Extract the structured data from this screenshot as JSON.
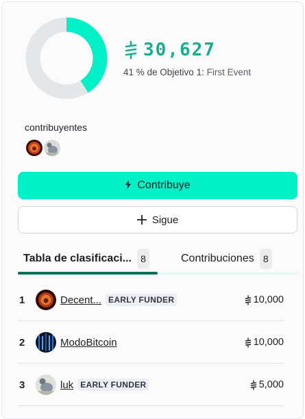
{
  "summary": {
    "amount": "30,627",
    "progress_percent": 41,
    "goal_prefix": "41 % de Objetivo 1:",
    "goal_name": "First Event"
  },
  "contributors": {
    "label": "contribuyentes",
    "avatars": [
      "avatar-lion",
      "avatar-pigeon"
    ]
  },
  "actions": {
    "contribute_label": "Contribuye",
    "follow_label": "Sigue"
  },
  "tabs": [
    {
      "label": "Tabla de clasificaci...",
      "count": "8",
      "active": true
    },
    {
      "label": "Contribuciones",
      "count": "8",
      "active": false
    }
  ],
  "leaderboard": [
    {
      "rank": "1",
      "name": "Decent...",
      "badge": "EARLY FUNDER",
      "amount": "10,000",
      "avatar": "lion"
    },
    {
      "rank": "2",
      "name": "ModoBitcoin",
      "badge": "",
      "amount": "10,000",
      "avatar": "matrix"
    },
    {
      "rank": "3",
      "name": "luk",
      "badge": "EARLY FUNDER",
      "amount": "5,000",
      "avatar": "pigeon"
    }
  ],
  "colors": {
    "accent": "#00f0c8",
    "amount_text": "#14b08e",
    "ring_track": "#e4e7ea",
    "tab_active": "#0a6e5c"
  }
}
